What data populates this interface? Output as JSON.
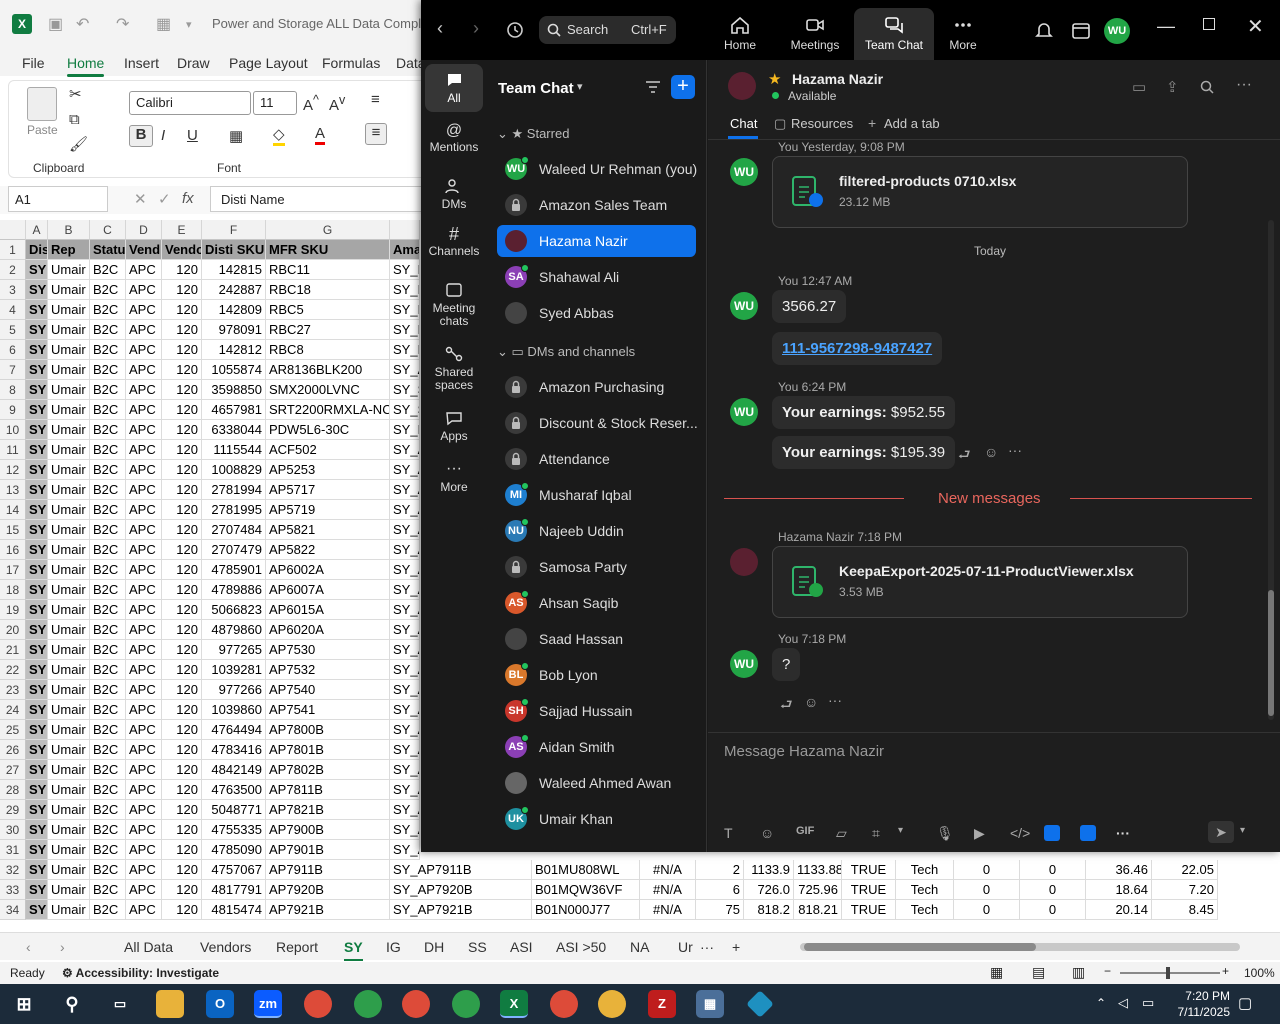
{
  "excel": {
    "title": "Power and Storage ALL Data Complete",
    "menu": [
      "File",
      "Home",
      "Insert",
      "Draw",
      "Page Layout",
      "Formulas",
      "Data"
    ],
    "font_name": "Calibri",
    "font_size": "11",
    "groups": {
      "clipboard": "Clipboard",
      "font": "Font",
      "paste": "Paste"
    },
    "name_box": "A1",
    "formula": "Disti Name",
    "columns": [
      "A",
      "B",
      "C",
      "D",
      "E",
      "F",
      "G"
    ],
    "header_row": [
      "Dis",
      "Rep",
      "Statu",
      "Vend",
      "Vendo",
      "Disti SKU",
      "MFR SKU",
      "Ama"
    ],
    "rows": [
      [
        "2",
        "SY",
        "Umair",
        "B2C",
        "APC",
        "120",
        "142815",
        "RBC11",
        "SY_F"
      ],
      [
        "3",
        "SY",
        "Umair",
        "B2C",
        "APC",
        "120",
        "242887",
        "RBC18",
        "SY_F"
      ],
      [
        "4",
        "SY",
        "Umair",
        "B2C",
        "APC",
        "120",
        "142809",
        "RBC5",
        "SY_F"
      ],
      [
        "5",
        "SY",
        "Umair",
        "B2C",
        "APC",
        "120",
        "978091",
        "RBC27",
        "SY_F"
      ],
      [
        "6",
        "SY",
        "Umair",
        "B2C",
        "APC",
        "120",
        "142812",
        "RBC8",
        "SY_F"
      ],
      [
        "7",
        "SY",
        "Umair",
        "B2C",
        "APC",
        "120",
        "1055874",
        "AR8136BLK200",
        "SY_A"
      ],
      [
        "8",
        "SY",
        "Umair",
        "B2C",
        "APC",
        "120",
        "3598850",
        "SMX2000LVNC",
        "SY_S"
      ],
      [
        "9",
        "SY",
        "Umair",
        "B2C",
        "APC",
        "120",
        "4657981",
        "SRT2200RMXLA-NC",
        "SY_S"
      ],
      [
        "10",
        "SY",
        "Umair",
        "B2C",
        "APC",
        "120",
        "6338044",
        "PDW5L6-30C",
        "SY_F"
      ],
      [
        "11",
        "SY",
        "Umair",
        "B2C",
        "APC",
        "120",
        "1115544",
        "ACF502",
        "SY_A"
      ],
      [
        "12",
        "SY",
        "Umair",
        "B2C",
        "APC",
        "120",
        "1008829",
        "AP5253",
        "SY_A"
      ],
      [
        "13",
        "SY",
        "Umair",
        "B2C",
        "APC",
        "120",
        "2781994",
        "AP5717",
        "SY_A"
      ],
      [
        "14",
        "SY",
        "Umair",
        "B2C",
        "APC",
        "120",
        "2781995",
        "AP5719",
        "SY_A"
      ],
      [
        "15",
        "SY",
        "Umair",
        "B2C",
        "APC",
        "120",
        "2707484",
        "AP5821",
        "SY_A"
      ],
      [
        "16",
        "SY",
        "Umair",
        "B2C",
        "APC",
        "120",
        "2707479",
        "AP5822",
        "SY_A"
      ],
      [
        "17",
        "SY",
        "Umair",
        "B2C",
        "APC",
        "120",
        "4785901",
        "AP6002A",
        "SY_A"
      ],
      [
        "18",
        "SY",
        "Umair",
        "B2C",
        "APC",
        "120",
        "4789886",
        "AP6007A",
        "SY_A"
      ],
      [
        "19",
        "SY",
        "Umair",
        "B2C",
        "APC",
        "120",
        "5066823",
        "AP6015A",
        "SY_A"
      ],
      [
        "20",
        "SY",
        "Umair",
        "B2C",
        "APC",
        "120",
        "4879860",
        "AP6020A",
        "SY_A"
      ],
      [
        "21",
        "SY",
        "Umair",
        "B2C",
        "APC",
        "120",
        "977265",
        "AP7530",
        "SY_A"
      ],
      [
        "22",
        "SY",
        "Umair",
        "B2C",
        "APC",
        "120",
        "1039281",
        "AP7532",
        "SY_A"
      ],
      [
        "23",
        "SY",
        "Umair",
        "B2C",
        "APC",
        "120",
        "977266",
        "AP7540",
        "SY_A"
      ],
      [
        "24",
        "SY",
        "Umair",
        "B2C",
        "APC",
        "120",
        "1039860",
        "AP7541",
        "SY_A"
      ],
      [
        "25",
        "SY",
        "Umair",
        "B2C",
        "APC",
        "120",
        "4764494",
        "AP7800B",
        "SY_A"
      ],
      [
        "26",
        "SY",
        "Umair",
        "B2C",
        "APC",
        "120",
        "4783416",
        "AP7801B",
        "SY_A"
      ],
      [
        "27",
        "SY",
        "Umair",
        "B2C",
        "APC",
        "120",
        "4842149",
        "AP7802B",
        "SY_A"
      ],
      [
        "28",
        "SY",
        "Umair",
        "B2C",
        "APC",
        "120",
        "4763500",
        "AP7811B",
        "SY_A"
      ],
      [
        "29",
        "SY",
        "Umair",
        "B2C",
        "APC",
        "120",
        "5048771",
        "AP7821B",
        "SY_A"
      ],
      [
        "30",
        "SY",
        "Umair",
        "B2C",
        "APC",
        "120",
        "4755335",
        "AP7900B",
        "SY_A"
      ],
      [
        "31",
        "SY",
        "Umair",
        "B2C",
        "APC",
        "120",
        "4785090",
        "AP7901B",
        "SY_A"
      ]
    ],
    "wide_rows": [
      [
        "32",
        "SY",
        "Umair",
        "B2C",
        "APC",
        "120",
        "4757067",
        "AP7911B",
        "SY_AP7911B",
        "B01MU808WL",
        "#N/A",
        "2",
        "1133.9",
        "1133.88",
        "TRUE",
        "Tech",
        "0",
        "0",
        "36.46",
        "22.05"
      ],
      [
        "33",
        "SY",
        "Umair",
        "B2C",
        "APC",
        "120",
        "4817791",
        "AP7920B",
        "SY_AP7920B",
        "B01MQW36VF",
        "#N/A",
        "6",
        "726.0",
        "725.96",
        "TRUE",
        "Tech",
        "0",
        "0",
        "18.64",
        "7.20"
      ],
      [
        "34",
        "SY",
        "Umair",
        "B2C",
        "APC",
        "120",
        "4815474",
        "AP7921B",
        "SY_AP7921B",
        "B01N000J77",
        "#N/A",
        "75",
        "818.2",
        "818.21",
        "TRUE",
        "Tech",
        "0",
        "0",
        "20.14",
        "8.45"
      ]
    ],
    "sheet_tabs": [
      "All Data",
      "Vendors",
      "Report",
      "SY",
      "IG",
      "DH",
      "SS",
      "ASI",
      "ASI >50",
      "NA",
      "Ur"
    ],
    "active_tab": "SY",
    "status": {
      "ready": "Ready",
      "accessibility": "Accessibility: Investigate",
      "zoom": "100%"
    }
  },
  "zoom": {
    "search": {
      "label": "Search",
      "shortcut": "Ctrl+F"
    },
    "nav": [
      "Home",
      "Meetings",
      "Team Chat",
      "More"
    ],
    "user_initials": "WU",
    "rail": [
      "All",
      "Mentions",
      "DMs",
      "Channels",
      "Meeting chats",
      "Shared spaces",
      "Apps",
      "More"
    ],
    "list_title": "Team Chat",
    "starred_label": "Starred",
    "dm_label": "DMs and channels",
    "starred": [
      {
        "name": "Waleed Ur Rehman (you)",
        "initials": "WU",
        "color": "#22a546"
      },
      {
        "name": "Amazon Sales Team",
        "lock": true
      },
      {
        "name": "Hazama Nazir",
        "color": "#5a2030",
        "selected": true
      },
      {
        "name": "Shahawal Ali",
        "initials": "SA",
        "color": "#8b3fb5"
      },
      {
        "name": "Syed Abbas",
        "color": "#444"
      }
    ],
    "channels": [
      {
        "name": "Amazon Purchasing",
        "lock": true
      },
      {
        "name": "Discount & Stock Reser...",
        "lock": true
      },
      {
        "name": "Attendance",
        "lock": true
      },
      {
        "name": "Musharaf Iqbal",
        "initials": "MI",
        "color": "#1e7fd0"
      },
      {
        "name": "Najeeb Uddin",
        "initials": "NU",
        "color": "#2a7ab5"
      },
      {
        "name": "Samosa Party",
        "lock": true
      },
      {
        "name": "Ahsan Saqib",
        "initials": "AS",
        "color": "#d9582b"
      },
      {
        "name": "Saad Hassan",
        "color": "#444"
      },
      {
        "name": "Bob Lyon",
        "initials": "BL",
        "color": "#d9782b"
      },
      {
        "name": "Sajjad Hussain",
        "initials": "SH",
        "color": "#c9362b"
      },
      {
        "name": "Aidan Smith",
        "initials": "AS",
        "color": "#8b3fb5"
      },
      {
        "name": "Waleed Ahmed Awan",
        "color": "#666"
      },
      {
        "name": "Umair Khan",
        "initials": "UK",
        "color": "#1e90a0"
      }
    ],
    "chat": {
      "contact": "Hazama Nazir",
      "presence": "Available",
      "tabs": [
        "Chat",
        "Resources",
        "Add a tab"
      ],
      "messages": {
        "m1_meta": "You Yesterday, 9:08 PM",
        "file1_name": "filtered-products 0710.xlsx",
        "file1_size": "23.12 MB",
        "today": "Today",
        "m2_meta": "You 12:47 AM",
        "m2_text": "3566.27",
        "m2_link": "111-9567298-9487427",
        "m3_meta": "You 6:24 PM",
        "earn_label": "Your earnings:",
        "earn1": "$952.55",
        "earn2": "$195.39",
        "new_messages": "New messages",
        "m4_meta": "Hazama Nazir 7:18 PM",
        "file2_name": "KeepaExport-2025-07-11-ProductViewer.xlsx",
        "file2_size": "3.53 MB",
        "m5_meta": "You 7:18 PM",
        "m5_text": "?"
      },
      "composer_placeholder": "Message Hazama Nazir"
    }
  },
  "taskbar": {
    "time": "7:20 PM",
    "date": "7/11/2025"
  }
}
